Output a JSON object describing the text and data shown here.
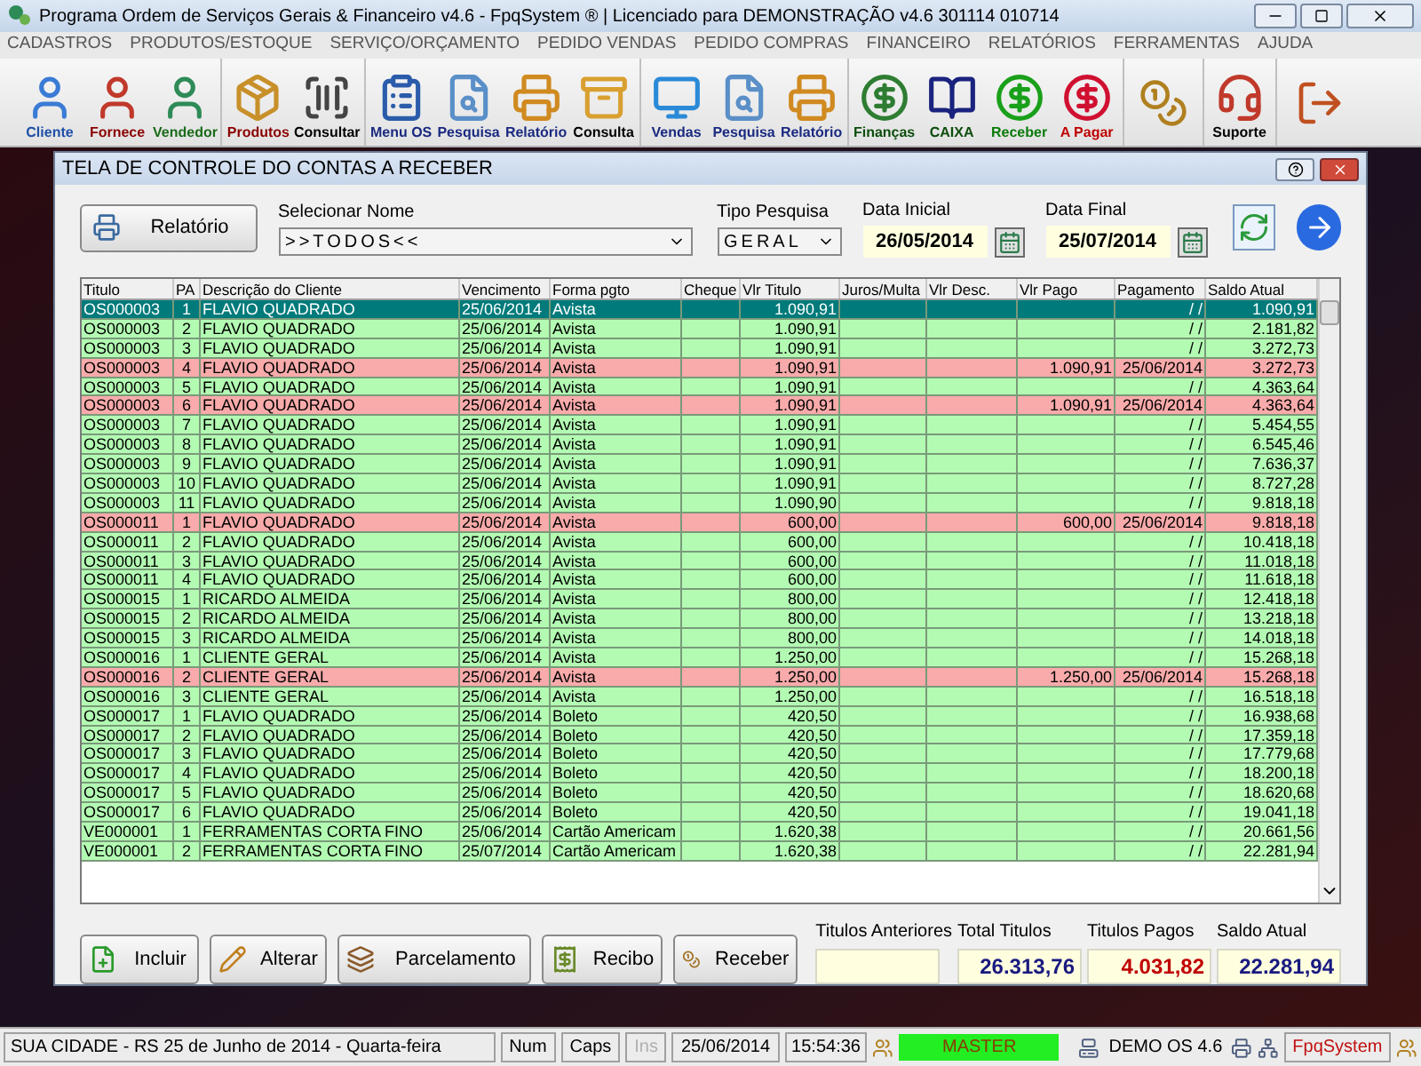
{
  "window": {
    "title": "Programa Ordem de Serviços Gerais & Financeiro v4.6 - FpqSystem ® | Licenciado para  DEMONSTRAÇÃO v4.6 301114 010714"
  },
  "menu": [
    "CADASTROS",
    "PRODUTOS/ESTOQUE",
    "SERVIÇO/ORÇAMENTO",
    "PEDIDO VENDAS",
    "PEDIDO COMPRAS",
    "FINANCEIRO",
    "RELATÓRIOS",
    "FERRAMENTAS",
    "AJUDA"
  ],
  "toolbar": [
    [
      {
        "label": "Cliente",
        "color": "#1f4fa8"
      },
      {
        "label": "Fornece",
        "color": "#8b0000"
      },
      {
        "label": "Vendedor",
        "color": "#1a6b1a"
      }
    ],
    [
      {
        "label": "Produtos",
        "color": "#8b0000"
      },
      {
        "label": "Consultar",
        "color": "#000000"
      }
    ],
    [
      {
        "label": "Menu OS",
        "color": "#1a2a80"
      },
      {
        "label": "Pesquisa",
        "color": "#1a2a80"
      },
      {
        "label": "Relatório",
        "color": "#1a2a80"
      },
      {
        "label": "Consulta",
        "color": "#000000"
      }
    ],
    [
      {
        "label": "Vendas",
        "color": "#1a2a80"
      },
      {
        "label": "Pesquisa",
        "color": "#1a2a80"
      },
      {
        "label": "Relatório",
        "color": "#1a2a80"
      }
    ],
    [
      {
        "label": "Finanças",
        "color": "#0d4d0d"
      },
      {
        "label": "CAIXA",
        "color": "#0d4d0d"
      },
      {
        "label": "Receber",
        "color": "#0a7a0a"
      },
      {
        "label": "A Pagar",
        "color": "#c00000"
      }
    ],
    [
      {
        "label": "Suporte",
        "color": "#000000"
      }
    ]
  ],
  "dialog": {
    "title": "TELA DE CONTROLE DO CONTAS A RECEBER",
    "report_button": "Relatório",
    "name_label": "Selecionar Nome",
    "name_value": ">>TODOS<<",
    "type_label": "Tipo  Pesquisa",
    "type_value": "GERAL",
    "start_label": "Data Inicial",
    "start_value": "26/05/2014",
    "end_label": "Data Final",
    "end_value": "25/07/2014"
  },
  "table": {
    "columns": [
      "Titulo",
      "PA",
      "Descrição do Cliente",
      "Vencimento",
      "Forma pgto",
      "Cheque",
      "Vlr Titulo",
      "Juros/Multa",
      "Vlr Desc.",
      "Vlr Pago",
      "Pagamento",
      "Saldo Atual"
    ],
    "rows": [
      {
        "titulo": "OS000003",
        "pa": "1",
        "cliente": "FLAVIO QUADRADO",
        "vencimento": "25/06/2014",
        "forma": "Avista",
        "vlr_titulo": "1.090,91",
        "pagamento": "/ /",
        "saldo": "1.090,91",
        "paid": false,
        "selected": true
      },
      {
        "titulo": "OS000003",
        "pa": "2",
        "cliente": "FLAVIO QUADRADO",
        "vencimento": "25/06/2014",
        "forma": "Avista",
        "vlr_titulo": "1.090,91",
        "pagamento": "/ /",
        "saldo": "2.181,82",
        "paid": false,
        "selected": false
      },
      {
        "titulo": "OS000003",
        "pa": "3",
        "cliente": "FLAVIO QUADRADO",
        "vencimento": "25/06/2014",
        "forma": "Avista",
        "vlr_titulo": "1.090,91",
        "pagamento": "/ /",
        "saldo": "3.272,73",
        "paid": false,
        "selected": false
      },
      {
        "titulo": "OS000003",
        "pa": "4",
        "cliente": "FLAVIO QUADRADO",
        "vencimento": "25/06/2014",
        "forma": "Avista",
        "vlr_titulo": "1.090,91",
        "vlr_pago": "1.090,91",
        "pagamento": "25/06/2014",
        "saldo": "3.272,73",
        "paid": true,
        "selected": false
      },
      {
        "titulo": "OS000003",
        "pa": "5",
        "cliente": "FLAVIO QUADRADO",
        "vencimento": "25/06/2014",
        "forma": "Avista",
        "vlr_titulo": "1.090,91",
        "pagamento": "/ /",
        "saldo": "4.363,64",
        "paid": false,
        "selected": false
      },
      {
        "titulo": "OS000003",
        "pa": "6",
        "cliente": "FLAVIO QUADRADO",
        "vencimento": "25/06/2014",
        "forma": "Avista",
        "vlr_titulo": "1.090,91",
        "vlr_pago": "1.090,91",
        "pagamento": "25/06/2014",
        "saldo": "4.363,64",
        "paid": true,
        "selected": false
      },
      {
        "titulo": "OS000003",
        "pa": "7",
        "cliente": "FLAVIO QUADRADO",
        "vencimento": "25/06/2014",
        "forma": "Avista",
        "vlr_titulo": "1.090,91",
        "pagamento": "/ /",
        "saldo": "5.454,55",
        "paid": false,
        "selected": false
      },
      {
        "titulo": "OS000003",
        "pa": "8",
        "cliente": "FLAVIO QUADRADO",
        "vencimento": "25/06/2014",
        "forma": "Avista",
        "vlr_titulo": "1.090,91",
        "pagamento": "/ /",
        "saldo": "6.545,46",
        "paid": false,
        "selected": false
      },
      {
        "titulo": "OS000003",
        "pa": "9",
        "cliente": "FLAVIO QUADRADO",
        "vencimento": "25/06/2014",
        "forma": "Avista",
        "vlr_titulo": "1.090,91",
        "pagamento": "/ /",
        "saldo": "7.636,37",
        "paid": false,
        "selected": false
      },
      {
        "titulo": "OS000003",
        "pa": "10",
        "cliente": "FLAVIO QUADRADO",
        "vencimento": "25/06/2014",
        "forma": "Avista",
        "vlr_titulo": "1.090,91",
        "pagamento": "/ /",
        "saldo": "8.727,28",
        "paid": false,
        "selected": false
      },
      {
        "titulo": "OS000003",
        "pa": "11",
        "cliente": "FLAVIO QUADRADO",
        "vencimento": "25/06/2014",
        "forma": "Avista",
        "vlr_titulo": "1.090,90",
        "pagamento": "/ /",
        "saldo": "9.818,18",
        "paid": false,
        "selected": false
      },
      {
        "titulo": "OS000011",
        "pa": "1",
        "cliente": "FLAVIO QUADRADO",
        "vencimento": "25/06/2014",
        "forma": "Avista",
        "vlr_titulo": "600,00",
        "vlr_pago": "600,00",
        "pagamento": "25/06/2014",
        "saldo": "9.818,18",
        "paid": true,
        "selected": false
      },
      {
        "titulo": "OS000011",
        "pa": "2",
        "cliente": "FLAVIO QUADRADO",
        "vencimento": "25/06/2014",
        "forma": "Avista",
        "vlr_titulo": "600,00",
        "pagamento": "/ /",
        "saldo": "10.418,18",
        "paid": false,
        "selected": false
      },
      {
        "titulo": "OS000011",
        "pa": "3",
        "cliente": "FLAVIO QUADRADO",
        "vencimento": "25/06/2014",
        "forma": "Avista",
        "vlr_titulo": "600,00",
        "pagamento": "/ /",
        "saldo": "11.018,18",
        "paid": false,
        "selected": false
      },
      {
        "titulo": "OS000011",
        "pa": "4",
        "cliente": "FLAVIO QUADRADO",
        "vencimento": "25/06/2014",
        "forma": "Avista",
        "vlr_titulo": "600,00",
        "pagamento": "/ /",
        "saldo": "11.618,18",
        "paid": false,
        "selected": false
      },
      {
        "titulo": "OS000015",
        "pa": "1",
        "cliente": "RICARDO ALMEIDA",
        "vencimento": "25/06/2014",
        "forma": "Avista",
        "vlr_titulo": "800,00",
        "pagamento": "/ /",
        "saldo": "12.418,18",
        "paid": false,
        "selected": false
      },
      {
        "titulo": "OS000015",
        "pa": "2",
        "cliente": "RICARDO ALMEIDA",
        "vencimento": "25/06/2014",
        "forma": "Avista",
        "vlr_titulo": "800,00",
        "pagamento": "/ /",
        "saldo": "13.218,18",
        "paid": false,
        "selected": false
      },
      {
        "titulo": "OS000015",
        "pa": "3",
        "cliente": "RICARDO ALMEIDA",
        "vencimento": "25/06/2014",
        "forma": "Avista",
        "vlr_titulo": "800,00",
        "pagamento": "/ /",
        "saldo": "14.018,18",
        "paid": false,
        "selected": false
      },
      {
        "titulo": "OS000016",
        "pa": "1",
        "cliente": "CLIENTE GERAL",
        "vencimento": "25/06/2014",
        "forma": "Avista",
        "vlr_titulo": "1.250,00",
        "pagamento": "/ /",
        "saldo": "15.268,18",
        "paid": false,
        "selected": false
      },
      {
        "titulo": "OS000016",
        "pa": "2",
        "cliente": "CLIENTE GERAL",
        "vencimento": "25/06/2014",
        "forma": "Avista",
        "vlr_titulo": "1.250,00",
        "vlr_pago": "1.250,00",
        "pagamento": "25/06/2014",
        "saldo": "15.268,18",
        "paid": true,
        "selected": false
      },
      {
        "titulo": "OS000016",
        "pa": "3",
        "cliente": "CLIENTE GERAL",
        "vencimento": "25/06/2014",
        "forma": "Avista",
        "vlr_titulo": "1.250,00",
        "pagamento": "/ /",
        "saldo": "16.518,18",
        "paid": false,
        "selected": false
      },
      {
        "titulo": "OS000017",
        "pa": "1",
        "cliente": "FLAVIO QUADRADO",
        "vencimento": "25/06/2014",
        "forma": "Boleto",
        "vlr_titulo": "420,50",
        "pagamento": "/ /",
        "saldo": "16.938,68",
        "paid": false,
        "selected": false
      },
      {
        "titulo": "OS000017",
        "pa": "2",
        "cliente": "FLAVIO QUADRADO",
        "vencimento": "25/06/2014",
        "forma": "Boleto",
        "vlr_titulo": "420,50",
        "pagamento": "/ /",
        "saldo": "17.359,18",
        "paid": false,
        "selected": false
      },
      {
        "titulo": "OS000017",
        "pa": "3",
        "cliente": "FLAVIO QUADRADO",
        "vencimento": "25/06/2014",
        "forma": "Boleto",
        "vlr_titulo": "420,50",
        "pagamento": "/ /",
        "saldo": "17.779,68",
        "paid": false,
        "selected": false
      },
      {
        "titulo": "OS000017",
        "pa": "4",
        "cliente": "FLAVIO QUADRADO",
        "vencimento": "25/06/2014",
        "forma": "Boleto",
        "vlr_titulo": "420,50",
        "pagamento": "/ /",
        "saldo": "18.200,18",
        "paid": false,
        "selected": false
      },
      {
        "titulo": "OS000017",
        "pa": "5",
        "cliente": "FLAVIO QUADRADO",
        "vencimento": "25/06/2014",
        "forma": "Boleto",
        "vlr_titulo": "420,50",
        "pagamento": "/ /",
        "saldo": "18.620,68",
        "paid": false,
        "selected": false
      },
      {
        "titulo": "OS000017",
        "pa": "6",
        "cliente": "FLAVIO QUADRADO",
        "vencimento": "25/06/2014",
        "forma": "Boleto",
        "vlr_titulo": "420,50",
        "pagamento": "/ /",
        "saldo": "19.041,18",
        "paid": false,
        "selected": false
      },
      {
        "titulo": "VE000001",
        "pa": "1",
        "cliente": "FERRAMENTAS CORTA FINO",
        "vencimento": "25/06/2014",
        "forma": "Cartão Americam",
        "vlr_titulo": "1.620,38",
        "pagamento": "/ /",
        "saldo": "20.661,56",
        "paid": false,
        "selected": false
      },
      {
        "titulo": "VE000001",
        "pa": "2",
        "cliente": "FERRAMENTAS CORTA FINO",
        "vencimento": "25/07/2014",
        "forma": "Cartão Americam",
        "vlr_titulo": "1.620,38",
        "pagamento": "/ /",
        "saldo": "22.281,94",
        "paid": false,
        "selected": false
      }
    ]
  },
  "actions": [
    "Incluir",
    "Alterar",
    "Parcelamento",
    "Recibo",
    "Receber"
  ],
  "totals": [
    {
      "label": "Titulos Anteriores"
    },
    {
      "label": "Total Titulos",
      "value": "26.313,76",
      "color": "#1a1a80"
    },
    {
      "label": "Titulos Pagos",
      "value": "4.031,82",
      "color": "#c00000"
    },
    {
      "label": "Saldo Atual",
      "value": "22.281,94",
      "color": "#1a1a80"
    }
  ],
  "status_bar": {
    "location": "SUA CIDADE - RS 25 de Junho de 2014 - Quarta-feira",
    "keys": [
      {
        "label": "Num",
        "disabled": false
      },
      {
        "label": "Caps",
        "disabled": false
      },
      {
        "label": "Ins",
        "disabled": true
      }
    ],
    "date": "25/06/2014",
    "time": "15:54:36",
    "user": "MASTER",
    "version": "DEMO OS 4.6",
    "brand": "FpqSystem"
  }
}
